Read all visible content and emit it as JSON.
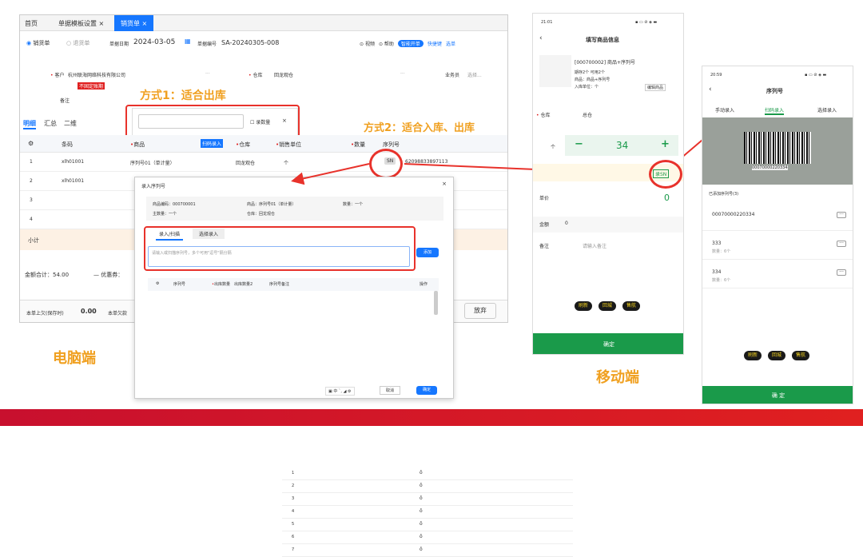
{
  "desktop": {
    "tabs": [
      "首页",
      "单据模板设置 ×",
      "销货单 ×"
    ],
    "radio_sale": "销货单",
    "radio_return": "退货单",
    "date_label": "单据日期",
    "date_value": "2024-03-05",
    "doc_label": "单据编号",
    "doc_value": "SA-20240305-008",
    "toolbar": [
      "视频",
      "帮助",
      "智能开单",
      "快捷键",
      "选单"
    ],
    "customer_label": "客户",
    "customer_value": "杭州联海网络科技有限公司",
    "warehouse_label": "仓库",
    "warehouse_value": "回龙观仓",
    "salesperson_label": "业务员",
    "salesperson_placeholder": "选择...",
    "tag": "不固定账期",
    "note_label": "备注",
    "method1": "方式1：适合出库",
    "method2": "方式2：适合入库、出库",
    "qty_checkbox": "录数量",
    "close_x": "×",
    "subtabs": [
      "明细",
      "汇总",
      "二维"
    ],
    "headers": [
      "条码",
      "商品",
      "扫码录入",
      "仓库",
      "销售单位",
      "数量",
      "序列号"
    ],
    "rows": [
      {
        "no": "1",
        "code": "xlh01001",
        "item": "序列号01（单计量）",
        "wh": "回龙观仓",
        "unit": "个",
        "sn": "SN",
        "serial": "62098833897113"
      },
      {
        "no": "2",
        "code": "xlh01001"
      },
      {
        "no": "3"
      },
      {
        "no": "4"
      }
    ],
    "subtotal": "小计",
    "total_label": "金额合计：54.00",
    "discount": "— 优惠券：",
    "footer_text": "本单上欠(保存时)",
    "footer_amount": "0.00",
    "footer_text2": "本单欠款",
    "giveup": "放弃",
    "ellipsis": "···"
  },
  "dialog": {
    "title": "录入序列号",
    "close": "×",
    "info": [
      "商品编码：000700001",
      "商品：序列号01（单计量）",
      "数量：一个",
      "主数量：一个",
      "仓库：回龙观仓"
    ],
    "tabs": [
      "录入/扫描",
      "选择录入"
    ],
    "placeholder": "请输入或扫描序列号，多个可用\"逗号\"隔分隔",
    "add": "添加",
    "headers": [
      "序列号",
      "出库数量",
      "出库数量2",
      "序列号备注",
      "操作"
    ],
    "rows": [
      "1",
      "2",
      "3",
      "4",
      "5",
      "6",
      "7"
    ],
    "cancel": "取消",
    "ok": "确定"
  },
  "label_pc": "电脑端",
  "label_mobile": "移动端",
  "phone1": {
    "time": "21:01",
    "title": "填写商品信息",
    "product": "[000700002] 商品+序列号",
    "stock": "期存2个  可用2个",
    "attr": "商品：商品+序列号",
    "unit": "入库单位：个",
    "edit": "编辑商品",
    "wh_label": "仓库",
    "wh_value": "总仓",
    "unit_label": "个",
    "qty": "34",
    "minus": "−",
    "plus": "+",
    "sn": "录SN",
    "price_label": "单价",
    "price": "0",
    "amount_label": "金额",
    "amount": "0",
    "note_label": "备注",
    "note_placeholder": "请输入备注",
    "btns": [
      "刷新",
      "回城",
      "售航"
    ],
    "confirm": "确定"
  },
  "phone2": {
    "time": "20:59",
    "title": "序列号",
    "tabs": [
      "手动录入",
      "扫码录入",
      "选择录入"
    ],
    "barcode": "00070000220334",
    "added": "已添加序列号(3)",
    "items": [
      {
        "sn": "00070000220334",
        "qty": ""
      },
      {
        "sn": "333",
        "qty": "数量：6个"
      },
      {
        "sn": "334",
        "qty": "数量：6个"
      }
    ],
    "btns": [
      "刷新",
      "回城",
      "售航"
    ],
    "confirm": "确 定",
    "more": "···"
  },
  "colors": {
    "accent": "#1677ff",
    "red": "#e8322b",
    "orange": "#f0a020",
    "green": "#1a9a4a"
  }
}
